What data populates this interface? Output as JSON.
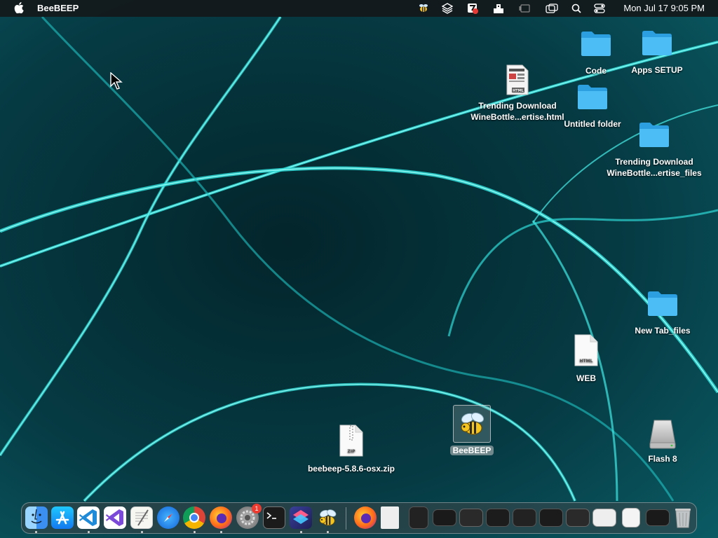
{
  "menubar": {
    "app_name": "BeeBEEP",
    "clock": "Mon Jul 17  9:05 PM",
    "status_icons": [
      "beebeep-icon",
      "layers-icon",
      "flag-icon",
      "dock-dock-icon",
      "display-icon",
      "window-icon",
      "search-icon",
      "control-center-icon"
    ]
  },
  "desktop": {
    "icons": {
      "code": "Code",
      "apps_setup": "Apps SETUP",
      "trending_html_1": "Trending Download",
      "trending_html_2": "WineBottle...ertise.html",
      "untitled": "Untitled folder",
      "trending_files_1": "Trending Download",
      "trending_files_2": "WineBottle...ertise_files",
      "newtab": "New Tab_files",
      "web": "WEB",
      "html_badge": "HTML",
      "beebeep": "BeeBEEP",
      "zip": "beebeep-5.8.6-osx.zip",
      "zip_badge": "ZIP",
      "flash": "Flash 8"
    }
  },
  "dock": {
    "apps": [
      "finder",
      "app-store",
      "vscode",
      "visual-studio",
      "textedit",
      "safari",
      "chrome",
      "firefox",
      "system-settings",
      "terminal",
      "shortcuts",
      "beebeep"
    ],
    "system_settings_badge": "1"
  },
  "colors": {
    "folder": "#3fb4f0",
    "accent": "#2de0e0"
  }
}
